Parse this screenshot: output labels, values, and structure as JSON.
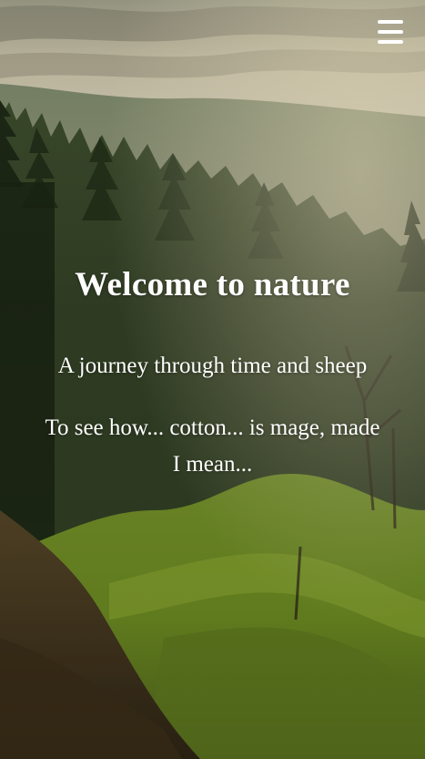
{
  "menu": {
    "icon": "hamburger-menu-icon"
  },
  "hero": {
    "title": "Welcome to nature",
    "paragraph1": "A journey through time and sheep",
    "paragraph2": "To see how... cotton... is mage, made I mean..."
  }
}
